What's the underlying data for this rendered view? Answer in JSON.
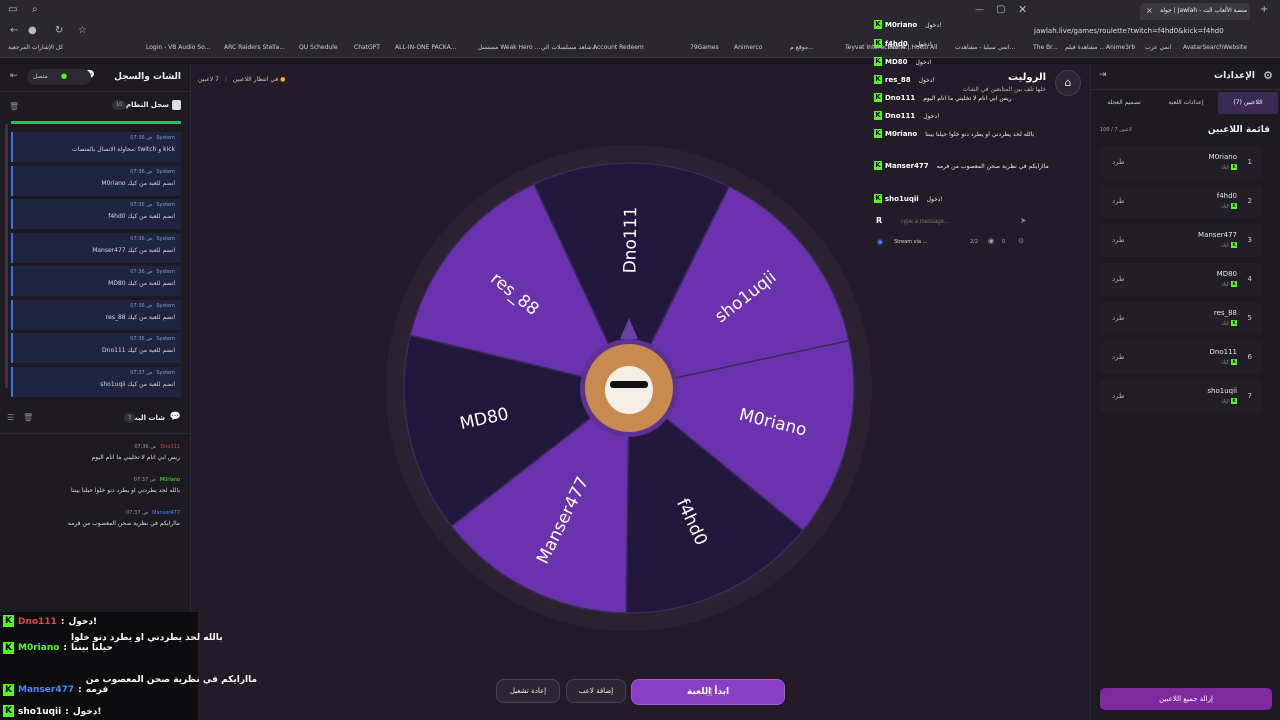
{
  "browser": {
    "tab_title": "جولة | Jawlah - منصة الألعاب الت",
    "url": "jawlah.live/games/roulette?twitch=f4hd0&kick=f4hd0",
    "bookmarks": [
      "كل الإشارات المرجعية",
      "Login - VB Audio So...",
      "ARC Raiders Stella...",
      "QU Schedule",
      "ChatGPT",
      "ALL-IN-ONE PACKA...",
      "مستسل Weak Hero ...",
      "شاهد مسلسلات الي...",
      "Account Redeem",
      "79Games",
      "Animerco",
      "موقع م...",
      "Teyvat Interactive M...",
      "Home | Hotto All",
      "انمي سيليا - مشاهدت...",
      "The Br...",
      "مشاهدة فيلم ...",
      "Anime3rb",
      "انمي عرب",
      "AvatarSearchWebsite"
    ]
  },
  "left_panel": {
    "title": "الشات والسجل",
    "status": "متصل",
    "system_log": {
      "title": "سجل النظام",
      "count": "10",
      "entries": [
        {
          "source": "System",
          "time": "07:36 ص",
          "text": "محاولة الاتصال بالمنصات: twitch و kick"
        },
        {
          "source": "System",
          "time": "07:36 ص",
          "text": "M0riano انضم للعبة من كيك"
        },
        {
          "source": "System",
          "time": "07:36 ص",
          "text": "f4hd0 انضم للعبة من كيك"
        },
        {
          "source": "System",
          "time": "07:36 ص",
          "text": "Manser477 انضم للعبة من كيك"
        },
        {
          "source": "System",
          "time": "07:36 ص",
          "text": "MD80 انضم للعبة من كيك"
        },
        {
          "source": "System",
          "time": "07:36 ص",
          "text": "res_88 انضم للعبة من كيك"
        },
        {
          "source": "System",
          "time": "07:36 ص",
          "text": "Dno111 انضم للعبة من كيك"
        },
        {
          "source": "System",
          "time": "07:37 ص",
          "text": "sho1uqii انضم للعبة من كيك"
        }
      ]
    },
    "bot_chat": {
      "title": "شات البث",
      "count": "3",
      "messages": [
        {
          "user": "Dno111",
          "time": "07:36 ص",
          "text": "ريس ابي انام لا تخليني ما انام اليوم"
        },
        {
          "user": "M0riano",
          "time": "07:37 ص",
          "text": "بالله لحد يطردني او يطرد دنو خلوا حيلنا بيننا"
        },
        {
          "user": "Manser477",
          "time": "07:37 ص",
          "text": "ماارايكم في نظرية صحن المعصوب من فرمه"
        }
      ]
    }
  },
  "main": {
    "players_count": "7 لاعبين",
    "status": "في انتظار اللاعبين",
    "title": "الروليت",
    "subtitle": "خلها تلف بين المتابعين في الشات",
    "wheel_segments": [
      "Dno111",
      "sho1uqii",
      "M0riano",
      "f4hd0",
      "Manser477",
      "MD80",
      "res_88"
    ],
    "wheel_colors": [
      "#22183e",
      "#6b32b0",
      "#6b32b0",
      "#22183e",
      "#6b32b0",
      "#22183e",
      "#6b32b0"
    ],
    "buttons": {
      "start": "ابدأ اللعبة",
      "add_player": "إضافة لاعب",
      "restart": "إعادة تشغيل"
    }
  },
  "right_panel": {
    "title": "الإعدادات",
    "tabs": [
      "اللاعبين (7)",
      "إعدادات اللعبة",
      "تصميم العجلة"
    ],
    "list_title": "قائمة اللاعبين",
    "list_count": "100 / 7 لاعبين",
    "kick_label": "طرد",
    "players": [
      {
        "index": "1",
        "name": "M0riano",
        "platform": "كيك"
      },
      {
        "index": "2",
        "name": "f4hd0",
        "platform": "كيك"
      },
      {
        "index": "3",
        "name": "Manser477",
        "platform": "كيك"
      },
      {
        "index": "4",
        "name": "MD80",
        "platform": "كيك"
      },
      {
        "index": "5",
        "name": "res_88",
        "platform": "كيك"
      },
      {
        "index": "6",
        "name": "Dno111",
        "platform": "كيك"
      },
      {
        "index": "7",
        "name": "sho1uqii",
        "platform": "كيك"
      }
    ],
    "remove_all": "إزالة جميع اللاعبين"
  },
  "overlay_chat": [
    {
      "user": "M0riano",
      "text": "دخول!"
    },
    {
      "user": "f4hd0",
      "text": "دخول!"
    },
    {
      "user": "MD80",
      "text": "دخول!"
    },
    {
      "user": "res_88",
      "text": "دخول!"
    },
    {
      "user": "Dno111",
      "text": "ريس ابي انام لا تخليني ما انام اليوم"
    },
    {
      "user": "Dno111",
      "text": "دخول!"
    },
    {
      "user": "M0riano",
      "text": "بالله لحد يطردني او يطرد دنو خلوا حيلنا بيننا"
    },
    {
      "user": "Manser477",
      "text": "ماارايكم في نظرية صحن المعصوب من فرمه"
    },
    {
      "user": "sho1uqii",
      "text": "دخول!"
    }
  ],
  "overlay_input": {
    "placeholder": "Type a message...",
    "stream_label": "Stream via ...",
    "viewers": "2/2",
    "zero": "0"
  },
  "bottom_chat": [
    {
      "user": "Dno111",
      "text": "دخول!"
    },
    {
      "user": "M0riano",
      "text": "بالله لحد يطردني او يطرد دنو خلوا حيلنا بيننا"
    },
    {
      "user": "Manser477",
      "text": "ماارايكم في نظرية صحن المعصوب من فرمه"
    },
    {
      "user": "sho1uqii",
      "text": "دخول!"
    }
  ]
}
